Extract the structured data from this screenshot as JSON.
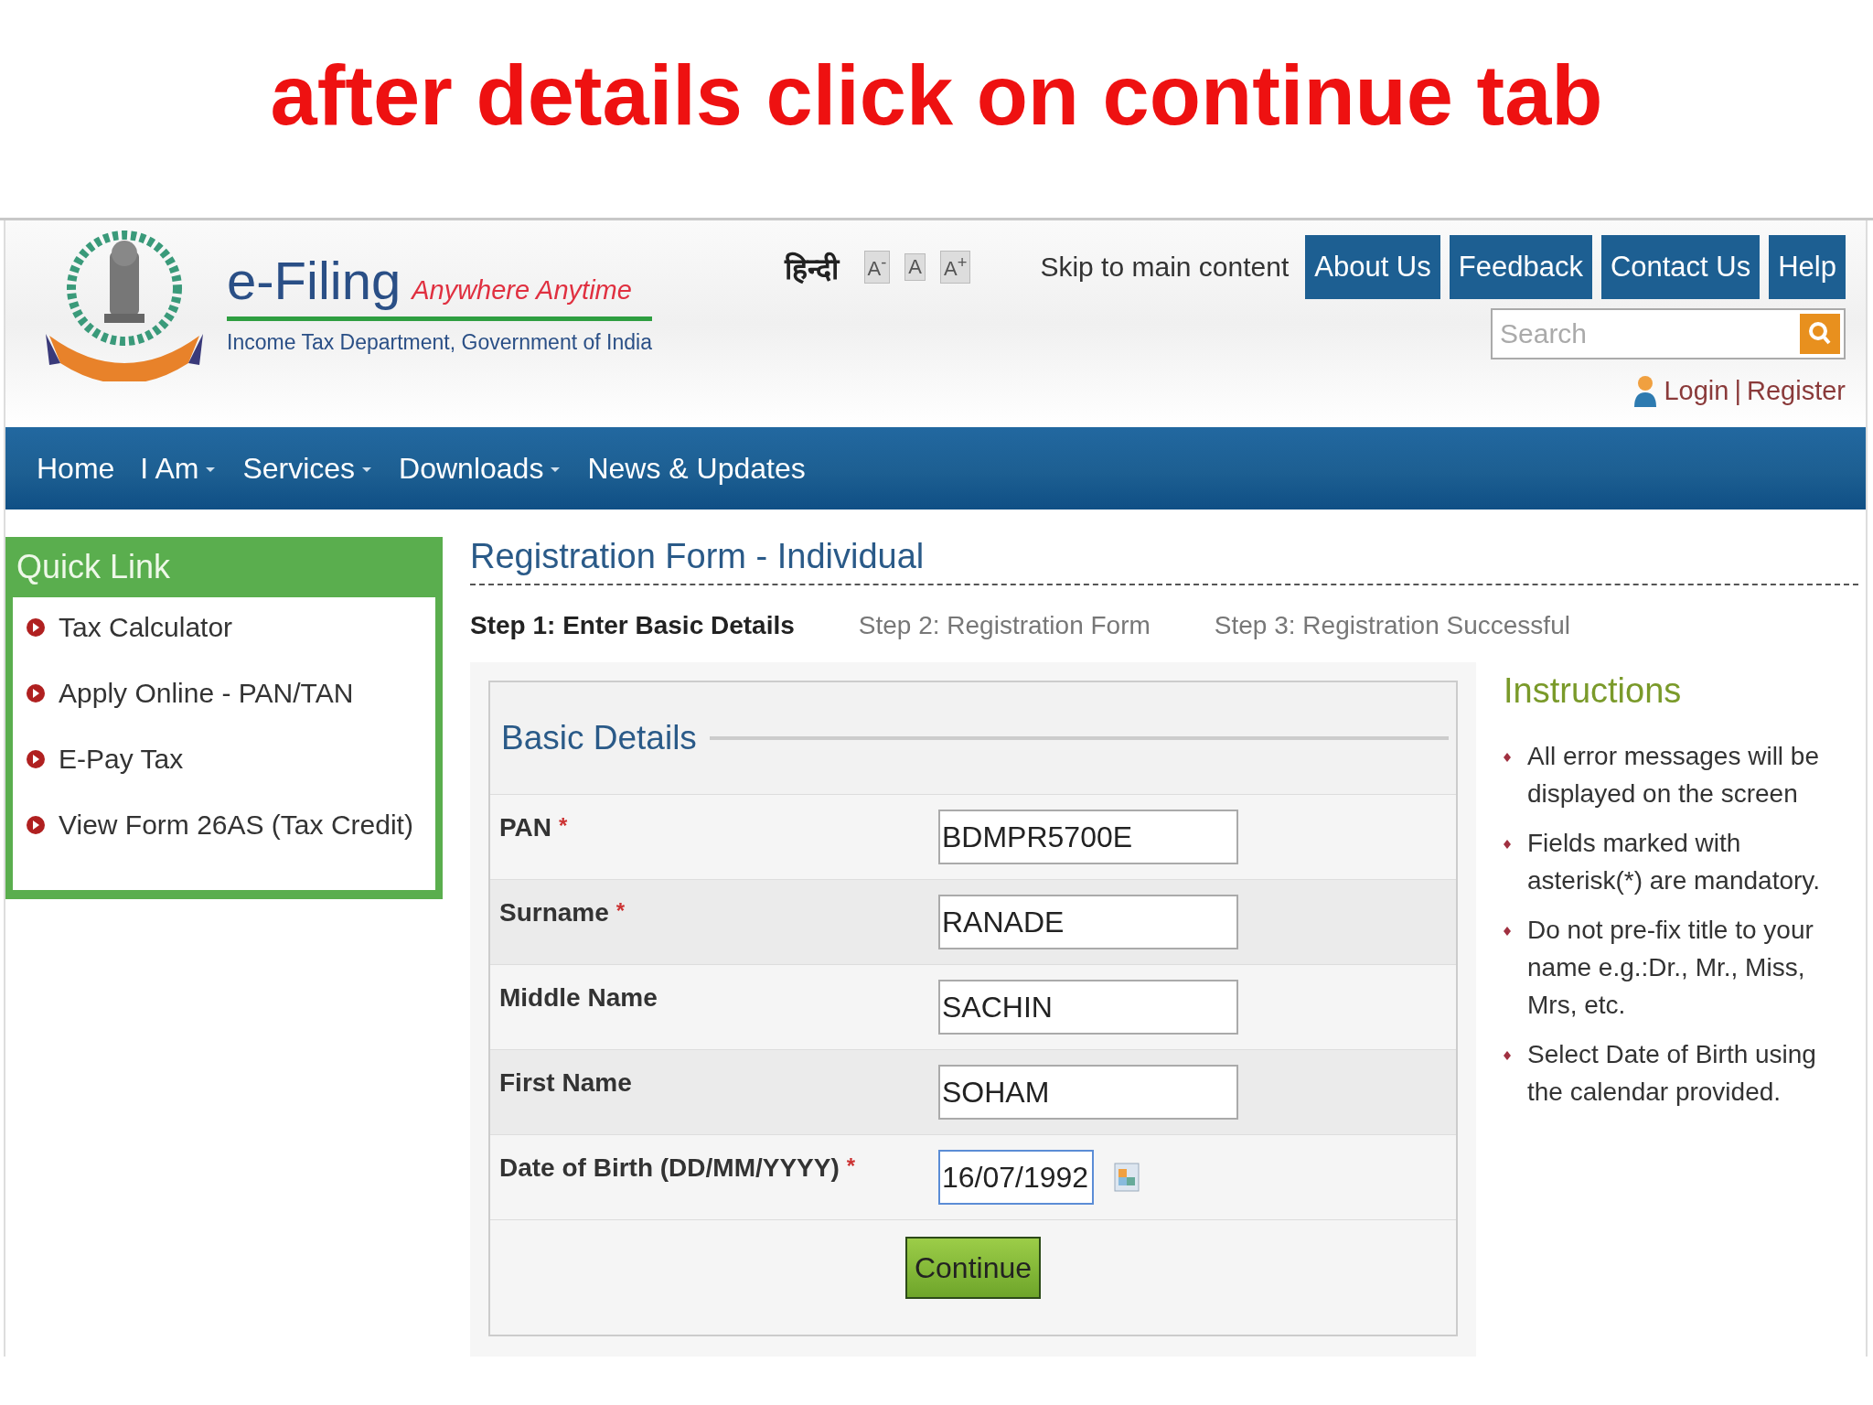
{
  "caption": "after details click on continue tab",
  "header": {
    "logo_title": "e-Filing",
    "tagline": "Anywhere Anytime",
    "subtitle": "Income Tax Department, Government of India",
    "language": "हिन्दी",
    "text_sizes": [
      "A$^{-}$",
      "A",
      "A$^{+}$"
    ],
    "skip_link": "Skip to main content",
    "top_buttons": [
      "About Us",
      "Feedback",
      "Contact Us",
      "Help"
    ],
    "search": {
      "placeholder": "Search"
    },
    "login": "Login",
    "separator": "|",
    "register": "Register"
  },
  "nav": [
    {
      "label": "Home",
      "dropdown": false
    },
    {
      "label": "I Am",
      "dropdown": true
    },
    {
      "label": "Services",
      "dropdown": true
    },
    {
      "label": "Downloads",
      "dropdown": true
    },
    {
      "label": "News & Updates",
      "dropdown": false
    }
  ],
  "quick_link": {
    "title": "Quick Link",
    "items": [
      "Tax Calculator",
      "Apply Online - PAN/TAN",
      "E-Pay Tax",
      "View Form 26AS (Tax Credit)"
    ]
  },
  "form": {
    "title": "Registration Form - Individual",
    "steps": [
      {
        "label": "Step 1: Enter Basic Details",
        "selected": true
      },
      {
        "label": "Step 2: Registration Form",
        "selected": false
      },
      {
        "label": "Step 3: Registration Successful",
        "selected": false
      }
    ],
    "section": "Basic Details",
    "fields": [
      {
        "kind": "text",
        "label": "PAN",
        "mark": "*",
        "value": "BDMPR5700E",
        "focused": false
      },
      {
        "kind": "text",
        "label": "Surname",
        "mark": "*",
        "value": "RANADE",
        "focused": false
      },
      {
        "kind": "text",
        "label": "Middle Name",
        "value": "SACHIN",
        "focused": false
      },
      {
        "kind": "text",
        "label": "First Name",
        "value": "SOHAM",
        "focused": false
      },
      {
        "kind": "date",
        "label": "Date of Birth (DD/MM/YYYY)",
        "mark": "*",
        "value": "16/07/1992",
        "focused": true
      }
    ],
    "button": "Continue"
  },
  "instructions": {
    "title": "Instructions",
    "items": [
      "All error messages will be displayed on the screen",
      "Fields marked with asterisk(*) are mandatory.",
      "Do not pre-fix title to your name e.g.:Dr., Mr., Miss, Mrs, etc.",
      "Select Date of Birth using the calendar provided."
    ]
  }
}
